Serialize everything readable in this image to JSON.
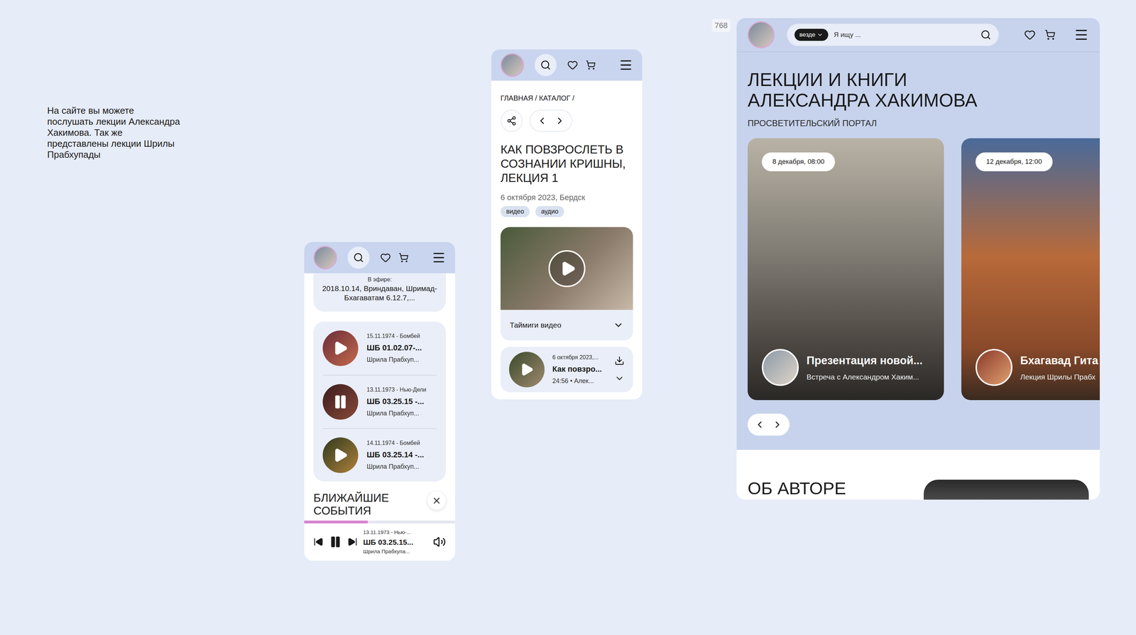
{
  "note": "На сайте вы можете послушать лекции Александра Хакимова. Так же представлены лекции Шрилы Прабхупады",
  "breakpoint": "768",
  "player_screen": {
    "on_air": {
      "label": "В эфире:",
      "title": "2018.10.14, Вриндаван, Шримад-Бхагаватам 6.12.7,..."
    },
    "tracks": [
      {
        "meta": "15.11.1974 - Бомбей",
        "title": "ШБ 01.02.07-...",
        "author": "Шрила Прабхуп...",
        "playing": false
      },
      {
        "meta": "13.11.1973 - Нью-Дели",
        "title": "ШБ 03.25.15 -...",
        "author": "Шрила Прабхуп...",
        "playing": true
      },
      {
        "meta": "14.11.1974 - Бомбей",
        "title": "ШБ 03.25.14 -...",
        "author": "Шрила Прабхуп...",
        "playing": false
      }
    ],
    "section_title": "БЛИЖАЙШИЕ СОБЫТИЯ",
    "player": {
      "meta": "13.11.1973 - Нью-...",
      "title": "ШБ 03.25.15...",
      "author": "Шрила Прабхупа...",
      "playing": true,
      "level": 0.42
    }
  },
  "lecture_screen": {
    "breadcrumb": "ГЛАВНАЯ / КАТАЛОГ /",
    "title": "КАК ПОВЗРОСЛЕТЬ В СОЗНАНИИ КРИШНЫ, ЛЕКЦИЯ 1",
    "date": "6 октября 2023, Бердск",
    "tags": [
      "видео",
      "аудио"
    ],
    "timecodes": "Таймиги видео",
    "item": {
      "meta": "6 октября 2023,...",
      "title": "Как повзро...",
      "info": "24:56 • Алек..."
    }
  },
  "home_screen": {
    "search_scope": "везде",
    "search_placeholder": "Я ищу ...",
    "title": "ЛЕКЦИИ И КНИГИ АЛЕКСАНДРА ХАКИМОВА",
    "subtitle": "ПРОСВЕТИТЕЛЬСКИЙ ПОРТАЛ",
    "cards": [
      {
        "date": "8 декабря, 08:00",
        "title": "Презентация новой...",
        "subtitle": "Встреча с Александром Хаким..."
      },
      {
        "date": "12 декабря, 12:00",
        "title": "Бхагавад Гита",
        "subtitle": "Лекция Шрилы Прабх"
      }
    ],
    "about_title": "ОБ АВТОРЕ"
  }
}
